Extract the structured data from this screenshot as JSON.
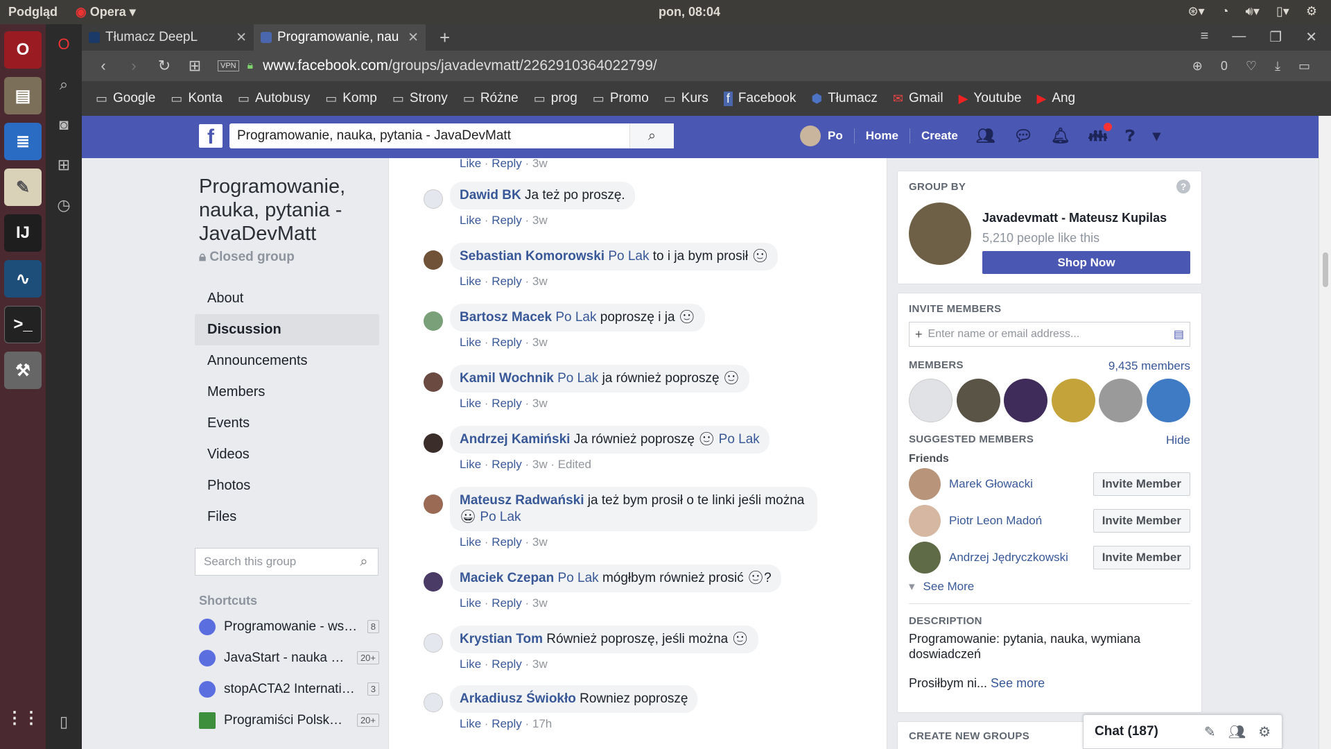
{
  "os": {
    "app_menu": "Podgląd",
    "app_name": "Opera",
    "clock": "pon, 08:04"
  },
  "browser": {
    "tabs": [
      {
        "label": "Tłumacz DeepL",
        "active": false
      },
      {
        "label": "Programowanie, nau",
        "active": true
      }
    ],
    "vpn": "VPN",
    "url_host": "www.facebook.com",
    "url_path": "/groups/javadevmatt/2262910364022799/",
    "adblock_count": "0",
    "bookmarks": [
      "Google",
      "Konta",
      "Autobusy",
      "Komp",
      "Strony",
      "Różne",
      "prog",
      "Promo",
      "Kurs",
      "Facebook",
      "Tłumacz",
      "Gmail",
      "Youtube",
      "Ang"
    ]
  },
  "fb": {
    "search_value": "Programowanie, nauka, pytania - JavaDevMatt",
    "user": "Po",
    "home": "Home",
    "create": "Create"
  },
  "group": {
    "title": "Programowanie, nauka, pytania - JavaDevMatt",
    "privacy": "Closed group",
    "nav": [
      "About",
      "Discussion",
      "Announcements",
      "Members",
      "Events",
      "Videos",
      "Photos",
      "Files"
    ],
    "search_placeholder": "Search this group",
    "shortcuts_label": "Shortcuts",
    "shortcuts": [
      {
        "name": "Programowanie - ws…",
        "count": "8"
      },
      {
        "name": "JavaStart - nauka p…",
        "count": "20+"
      },
      {
        "name": "stopACTA2 Internatio…",
        "count": "3"
      },
      {
        "name": "Programiści Polska…",
        "count": "20+"
      }
    ]
  },
  "comments": [
    {
      "author": "Dawid BK",
      "tag": "",
      "text": "Ja też po proszę.",
      "tag_after": "",
      "actions": {
        "like": "Like",
        "reply": "Reply",
        "time": "3w",
        "extra": ""
      }
    },
    {
      "author": "Sebastian Komorowski",
      "tag": "Po Lak",
      "text": "to i ja bym prosił 🙂",
      "tag_after": "",
      "actions": {
        "like": "Like",
        "reply": "Reply",
        "time": "3w",
        "extra": ""
      }
    },
    {
      "author": "Bartosz Macek",
      "tag": "Po Lak",
      "text": "poproszę i ja 🙂",
      "tag_after": "",
      "actions": {
        "like": "Like",
        "reply": "Reply",
        "time": "3w",
        "extra": ""
      }
    },
    {
      "author": "Kamil Wochnik",
      "tag": "Po Lak",
      "text": "ja również poproszę 🙂",
      "tag_after": "",
      "actions": {
        "like": "Like",
        "reply": "Reply",
        "time": "3w",
        "extra": ""
      }
    },
    {
      "author": "Andrzej Kamiński",
      "tag": "",
      "text": "Ja również poproszę 🙂",
      "tag_after": "Po Lak",
      "actions": {
        "like": "Like",
        "reply": "Reply",
        "time": "3w",
        "extra": "Edited"
      }
    },
    {
      "author": "Mateusz Radwański",
      "tag": "",
      "text": "ja też bym prosił o te linki jeśli można 😀",
      "tag_after": "Po Lak",
      "actions": {
        "like": "Like",
        "reply": "Reply",
        "time": "3w",
        "extra": ""
      }
    },
    {
      "author": "Maciek Czepan",
      "tag": "Po Lak",
      "text": "mógłbym również prosić 🙂?",
      "tag_after": "",
      "actions": {
        "like": "Like",
        "reply": "Reply",
        "time": "3w",
        "extra": ""
      }
    },
    {
      "author": "Krystian Tom",
      "tag": "",
      "text": "Również poproszę, jeśli można 🙂",
      "tag_after": "",
      "actions": {
        "like": "Like",
        "reply": "Reply",
        "time": "3w",
        "extra": ""
      }
    },
    {
      "author": "Arkadiusz Świokło",
      "tag": "",
      "text": "Rowniez poproszę",
      "tag_after": "",
      "actions": {
        "like": "Like",
        "reply": "Reply",
        "time": "17h",
        "extra": ""
      }
    }
  ],
  "top_actions": {
    "like": "Like",
    "reply": "Reply",
    "time": "3w"
  },
  "right": {
    "group_by_label": "GROUP BY",
    "page_name": "Javadevmatt - Mateusz Kupilas",
    "likes": "5,210 people like this",
    "shop": "Shop Now",
    "invite_label": "INVITE MEMBERS",
    "invite_placeholder": "Enter name or email address...",
    "members_label": "MEMBERS",
    "members_count": "9,435 members",
    "suggested_label": "SUGGESTED MEMBERS",
    "hide": "Hide",
    "friends": "Friends",
    "suggested": [
      {
        "name": "Marek Głowacki",
        "btn": "Invite Member"
      },
      {
        "name": "Piotr Leon Madoń",
        "btn": "Invite Member"
      },
      {
        "name": "Andrzej Jędryczkowski",
        "btn": "Invite Member"
      }
    ],
    "see_more": "See More",
    "description_label": "DESCRIPTION",
    "description": "Programowanie: pytania, nauka, wymiana doswiadczeń",
    "description2": "Prosiłbym ni...",
    "desc_see_more": "See more",
    "create_groups": "CREATE NEW GROUPS"
  },
  "chat": {
    "label": "Chat (187)"
  }
}
